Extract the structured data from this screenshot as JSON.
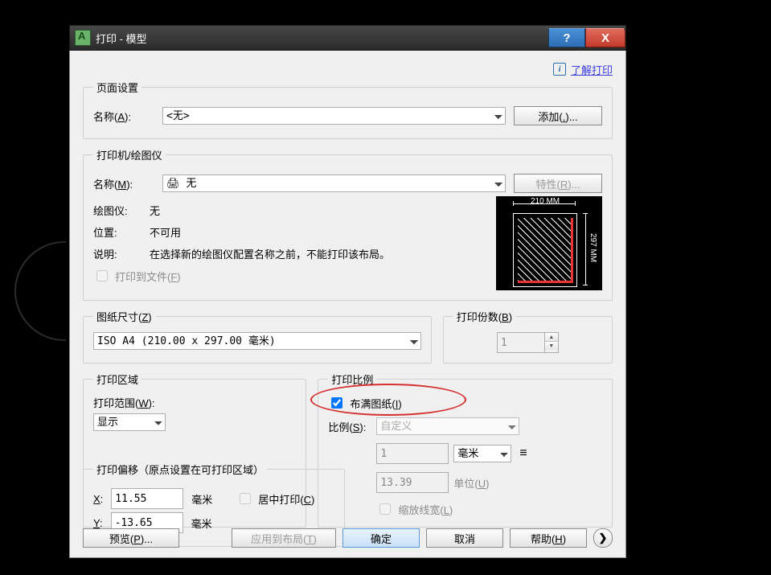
{
  "window": {
    "title": "打印 - 模型"
  },
  "help_link": "了解打印",
  "page_setup": {
    "legend": "页面设置",
    "name_label_pre": "名称(",
    "name_u": "A",
    "name_label_post": "):",
    "name_value": "<无>",
    "add_btn_pre": "添加(",
    "add_btn_u": ".",
    "add_btn_post": ")..."
  },
  "printer": {
    "legend": "打印机/绘图仪",
    "name_label_pre": "名称(",
    "name_u": "M",
    "name_label_post": "):",
    "name_value": "无",
    "props_btn_pre": "特性(",
    "props_btn_u": "R",
    "props_btn_post": ")...",
    "plotter_label": "绘图仪:",
    "plotter_value": "无",
    "where_label": "位置:",
    "where_value": "不可用",
    "desc_label": "说明:",
    "desc_value": "在选择新的绘图仪配置名称之前，不能打印该布局。",
    "to_file_pre": "打印到文件(",
    "to_file_u": "F",
    "to_file_post": ")",
    "preview_w": "210 MM",
    "preview_h": "297 MM"
  },
  "paper": {
    "legend_pre": "图纸尺寸(",
    "legend_u": "Z",
    "legend_post": ")",
    "size": "ISO A4 (210.00 x 297.00 毫米)"
  },
  "copies": {
    "legend_pre": "打印份数(",
    "legend_u": "B",
    "legend_post": ")",
    "value": "1"
  },
  "area": {
    "legend": "打印区域",
    "range_label_pre": "打印范围(",
    "range_u": "W",
    "range_post": "):",
    "range_value": "显示"
  },
  "scale": {
    "legend": "打印比例",
    "fit_pre": "布满图纸(",
    "fit_u": "I",
    "fit_post": ")",
    "ratio_label_pre": "比例(",
    "ratio_u": "S",
    "ratio_post": "):",
    "ratio_value": "自定义",
    "value1": "1",
    "unit1": "毫米",
    "value2": "13.39",
    "unit2_pre": "单位(",
    "unit2_u": "U",
    "unit2_post": ")",
    "scale_lw_pre": "缩放线宽(",
    "scale_lw_u": "L",
    "scale_lw_post": ")"
  },
  "offset": {
    "legend": "打印偏移（原点设置在可打印区域）",
    "x_u": "X",
    "x_after": ":",
    "x_value": "11.55",
    "x_unit": "毫米",
    "center_pre": "居中打印(",
    "center_u": "C",
    "center_post": ")",
    "y_u": "Y",
    "y_after": ":",
    "y_value": "-13.65",
    "y_unit": "毫米"
  },
  "footer": {
    "preview_pre": "预览(",
    "preview_u": "P",
    "preview_post": ")...",
    "apply_pre": "应用到布局(",
    "apply_u": "T",
    "apply_post": ")",
    "ok": "确定",
    "cancel": "取消",
    "help_pre": "帮助(",
    "help_u": "H",
    "help_post": ")"
  }
}
